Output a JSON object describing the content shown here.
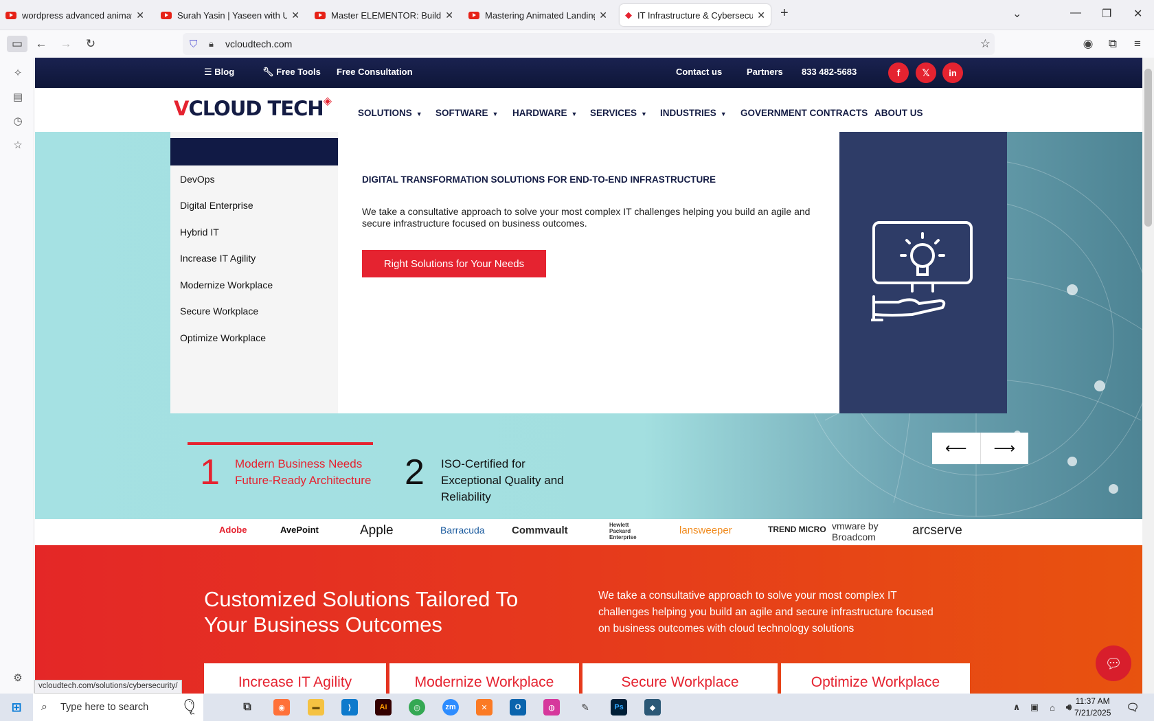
{
  "browser": {
    "tabs": [
      {
        "title": "wordpress advanced animation"
      },
      {
        "title": "Surah Yasin | Yaseen with Urdu T"
      },
      {
        "title": "Master ELEMENTOR: Build a Re"
      },
      {
        "title": "Mastering Animated Landing Pa"
      },
      {
        "title": "IT Infrastructure & Cybersecurit"
      }
    ],
    "url": "vcloudtech.com",
    "status_url": "vcloudtech.com/solutions/cybersecurity/"
  },
  "topbar": {
    "blog": "Blog",
    "free_tools": "Free Tools",
    "free_consultation": "Free Consultation",
    "contact": "Contact us",
    "partners": "Partners",
    "phone": "833 482-5683",
    "social": [
      "f",
      "𝕏",
      "in"
    ]
  },
  "header": {
    "logo_a": "V",
    "logo_b": "CLOUD TECH",
    "nav": [
      {
        "label": "SOLUTIONS",
        "has_caret": true
      },
      {
        "label": "SOFTWARE",
        "has_caret": true
      },
      {
        "label": "HARDWARE",
        "has_caret": true
      },
      {
        "label": "SERVICES",
        "has_caret": true
      },
      {
        "label": "INDUSTRIES",
        "has_caret": true
      },
      {
        "label": "GOVERNMENT CONTRACTS",
        "has_caret": false
      },
      {
        "label": "ABOUT US",
        "has_caret": false
      }
    ]
  },
  "mega": {
    "items": [
      "DevOps",
      "Digital Enterprise",
      "Hybrid IT",
      "Increase IT Agility",
      "Modernize Workplace",
      "Secure Workplace",
      "Optimize Workplace"
    ],
    "heading": "DIGITAL TRANSFORMATION SOLUTIONS FOR END-TO-END INFRASTRUCTURE",
    "desc": "We take a consultative approach to solve your most complex IT challenges helping you build an agile and secure infrastructure focused on business outcomes.",
    "cta": "Right Solutions for Your Needs"
  },
  "slides": [
    {
      "num": "1",
      "text": "Modern Business Needs Future-Ready Architecture"
    },
    {
      "num": "2",
      "text": "ISO-Certified for Exceptional Quality and Reliability"
    }
  ],
  "partners": [
    "Adobe",
    "AvePoint",
    "Apple",
    "Barracuda",
    "Commvault",
    "Hewlett Packard Enterprise",
    "lansweeper",
    "TREND MICRO",
    "vmware by Broadcom",
    "arcserve"
  ],
  "solutions": {
    "heading": "Customized Solutions Tailored To Your Business Outcomes",
    "desc": "We take a consultative approach to solve your most complex IT challenges helping you build an agile and secure infrastructure focused on business outcomes with cloud technology solutions",
    "cards": [
      "Increase IT Agility",
      "Modernize Workplace",
      "Secure Workplace",
      "Optimize Workplace"
    ]
  },
  "taskbar": {
    "search_placeholder": "Type here to search",
    "time": "11:37 AM",
    "date": "7/21/2025"
  },
  "colors": {
    "brand_red": "#e52330",
    "navy": "#111a45",
    "panel_blue": "#2e3c67"
  }
}
